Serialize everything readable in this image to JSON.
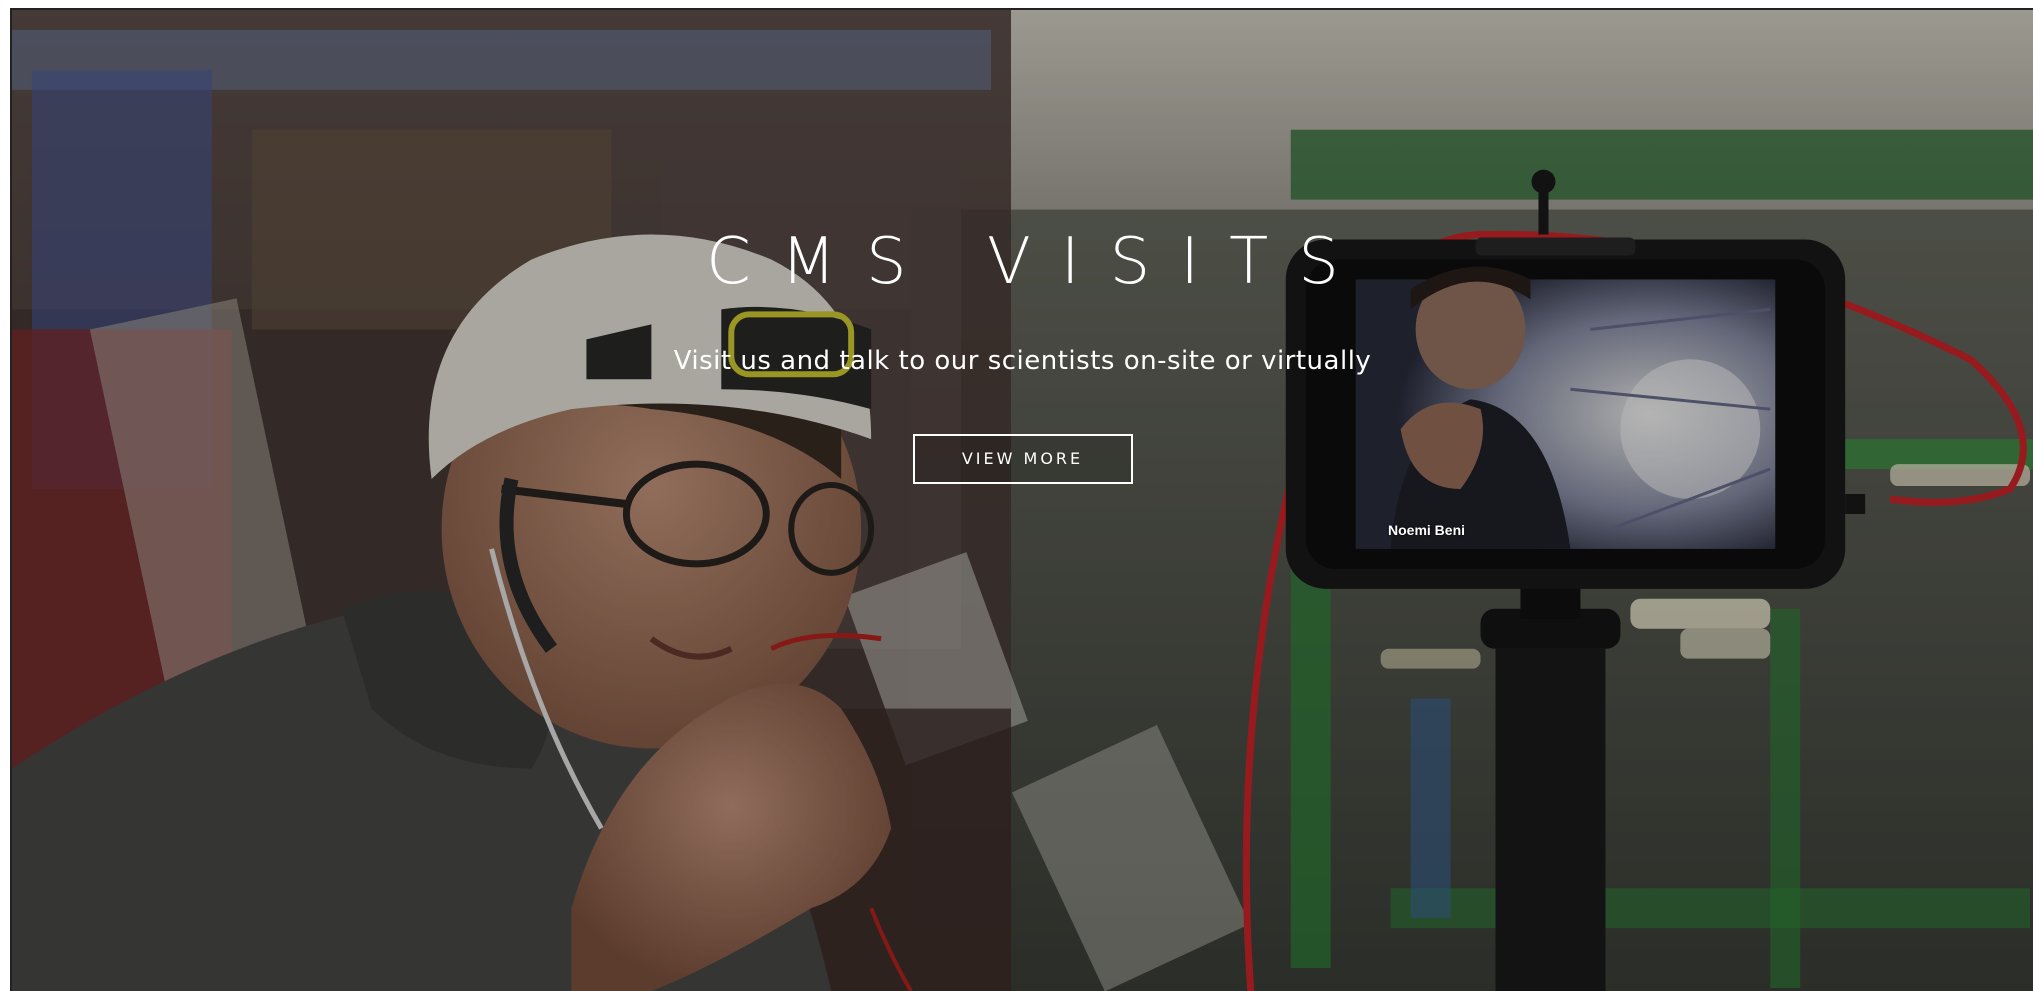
{
  "hero": {
    "title": "CMS VISITS",
    "subtitle": "Visit us and talk to our scientists on-site or virtually",
    "cta_label": "VIEW MORE",
    "photo_caption": "Noemi Beni"
  },
  "colors": {
    "text": "#ffffff",
    "button_border": "#ffffff",
    "cable_red": "#d2262a",
    "helmet": "#e9e6dc",
    "sweater": "#4a4a48",
    "green_structure": "#2f8a3a"
  },
  "icons": {
    "hero_photo": "background-photo"
  }
}
